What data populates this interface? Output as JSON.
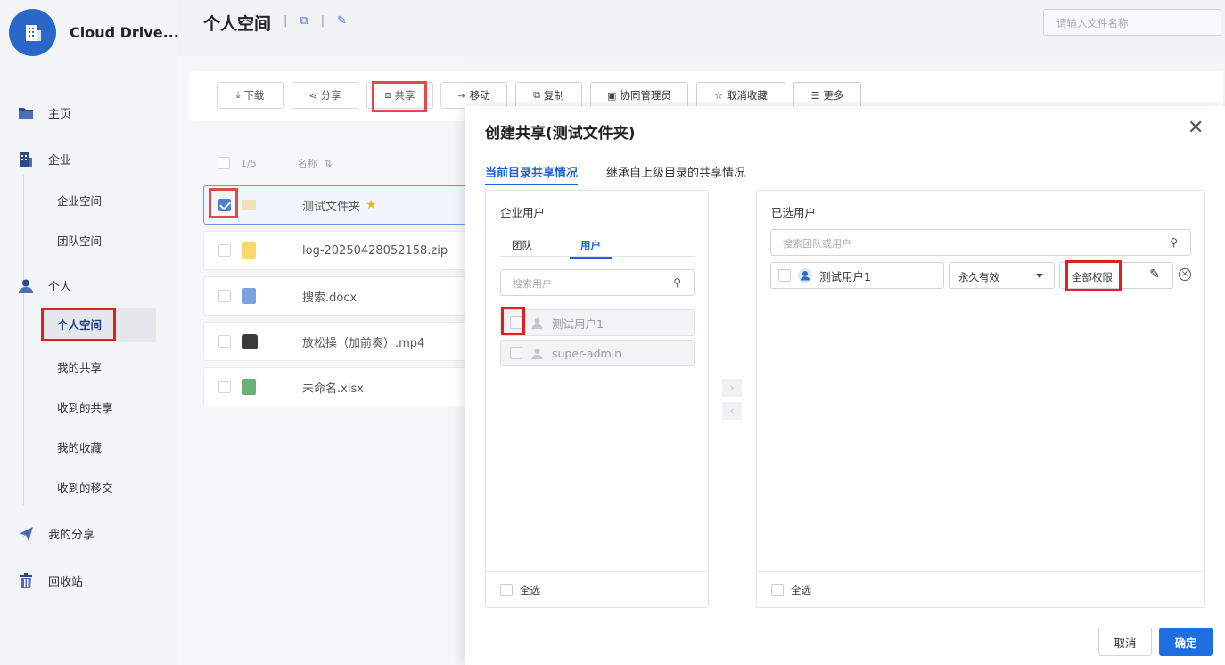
{
  "app": {
    "name": "Cloud Drive..."
  },
  "sidebar": {
    "items": [
      {
        "label": "主页",
        "icon": "folder-icon"
      },
      {
        "label": "企业",
        "icon": "building-icon"
      },
      {
        "label": "企业空间"
      },
      {
        "label": "团队空间"
      },
      {
        "label": "个人",
        "icon": "user-icon"
      },
      {
        "label": "个人空间",
        "active": true
      },
      {
        "label": "我的共享"
      },
      {
        "label": "收到的共享"
      },
      {
        "label": "我的收藏"
      },
      {
        "label": "收到的移交"
      },
      {
        "label": "我的分享",
        "icon": "send-icon"
      },
      {
        "label": "回收站",
        "icon": "trash-icon"
      }
    ]
  },
  "header": {
    "title": "个人空间",
    "search_placeholder": "请输入文件名称"
  },
  "toolbar": {
    "download": "下载",
    "share_link": "分享",
    "share": "共享",
    "move": "移动",
    "copy": "复制",
    "collaborator": "协同管理员",
    "unfavorite": "取消收藏",
    "more": "更多"
  },
  "file_list": {
    "count": "1/5",
    "name_header": "名称",
    "files": [
      {
        "name": "测试文件夹",
        "selected": true,
        "starred": true
      },
      {
        "name": "log-20250428052158.zip"
      },
      {
        "name": "搜索.docx"
      },
      {
        "name": "放松操（加前奏）.mp4"
      },
      {
        "name": "未命名.xlsx"
      }
    ]
  },
  "modal": {
    "title": "创建共享(测试文件夹)",
    "tabs": [
      "当前目录共享情况",
      "继承自上级目录的共享情况"
    ],
    "left_panel": {
      "title": "企业用户",
      "subtabs": [
        "团队",
        "用户"
      ],
      "search_placeholder": "搜索用户",
      "users": [
        "测试用户1",
        "super-admin"
      ],
      "select_all": "全选"
    },
    "right_panel": {
      "title": "已选用户",
      "search_placeholder": "搜索团队或用户",
      "selected": {
        "user": "测试用户1",
        "validity": "永久有效",
        "permission": "全部权限"
      },
      "select_all": "全选"
    },
    "cancel": "取消",
    "confirm": "确定"
  },
  "colors": {
    "accent": "#1f6ee0",
    "highlight": "#e02020",
    "brand": "#2a67c9"
  }
}
